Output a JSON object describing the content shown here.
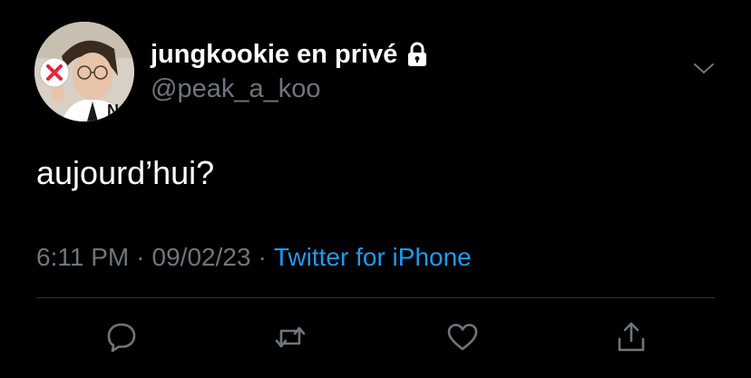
{
  "tweet": {
    "display_name": "jungkookie en privé",
    "handle": "@peak_a_koo",
    "text": "aujourd’hui?",
    "time": "6:11 PM",
    "date": "09/02/23",
    "separator": "·",
    "source": "Twitter for iPhone",
    "protected": true
  },
  "avatar": {
    "logo_letter": "N"
  },
  "actions": {
    "reply": "reply-icon",
    "retweet": "retweet-icon",
    "like": "heart-icon",
    "share": "share-icon"
  },
  "colors": {
    "background": "#000000",
    "primary_text": "#ffffff",
    "secondary_text": "#6e767d",
    "link": "#1d9bf0",
    "divider": "#2f3336"
  }
}
